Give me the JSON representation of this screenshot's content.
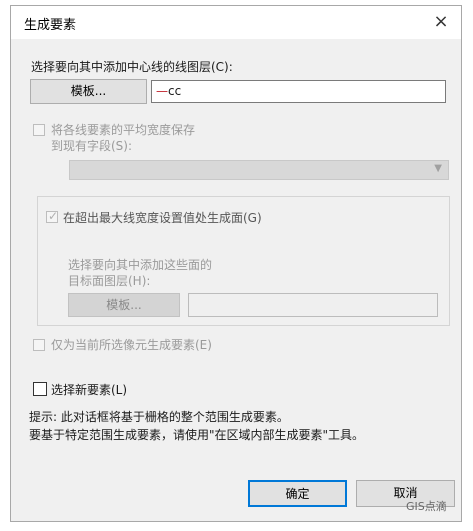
{
  "window": {
    "title": "生成要素",
    "close_glyph": "×"
  },
  "layer_section": {
    "label": "选择要向其中添加中心线的线图层(C):",
    "template_button": "模板...",
    "layer_value_prefix": "—",
    "layer_value": "cc"
  },
  "save_width": {
    "label_line1": "将各线要素的平均宽度保存",
    "label_line2": "到现有字段(S):",
    "checked": false,
    "enabled": false
  },
  "polygon_group": {
    "checkbox_label": "在超出最大线宽度设置值处生成面(G)",
    "checked": true,
    "enabled": false,
    "sub_label_line1": "选择要向其中添加这些面的",
    "sub_label_line2": "目标面图层(H):",
    "template_button": "模板..."
  },
  "selected_only": {
    "label": "仅为当前所选像元生成要素(E)",
    "enabled": false
  },
  "select_new": {
    "label": "选择新要素(L)",
    "checked": false
  },
  "hint": {
    "line1": "提示: 此对话框将基于栅格的整个范围生成要素。",
    "line2": "要基于特定范围生成要素，请使用\"在区域内部生成要素\"工具。"
  },
  "buttons": {
    "ok": "确定",
    "cancel": "取消"
  },
  "watermark": {
    "text": "GIS点滴"
  }
}
